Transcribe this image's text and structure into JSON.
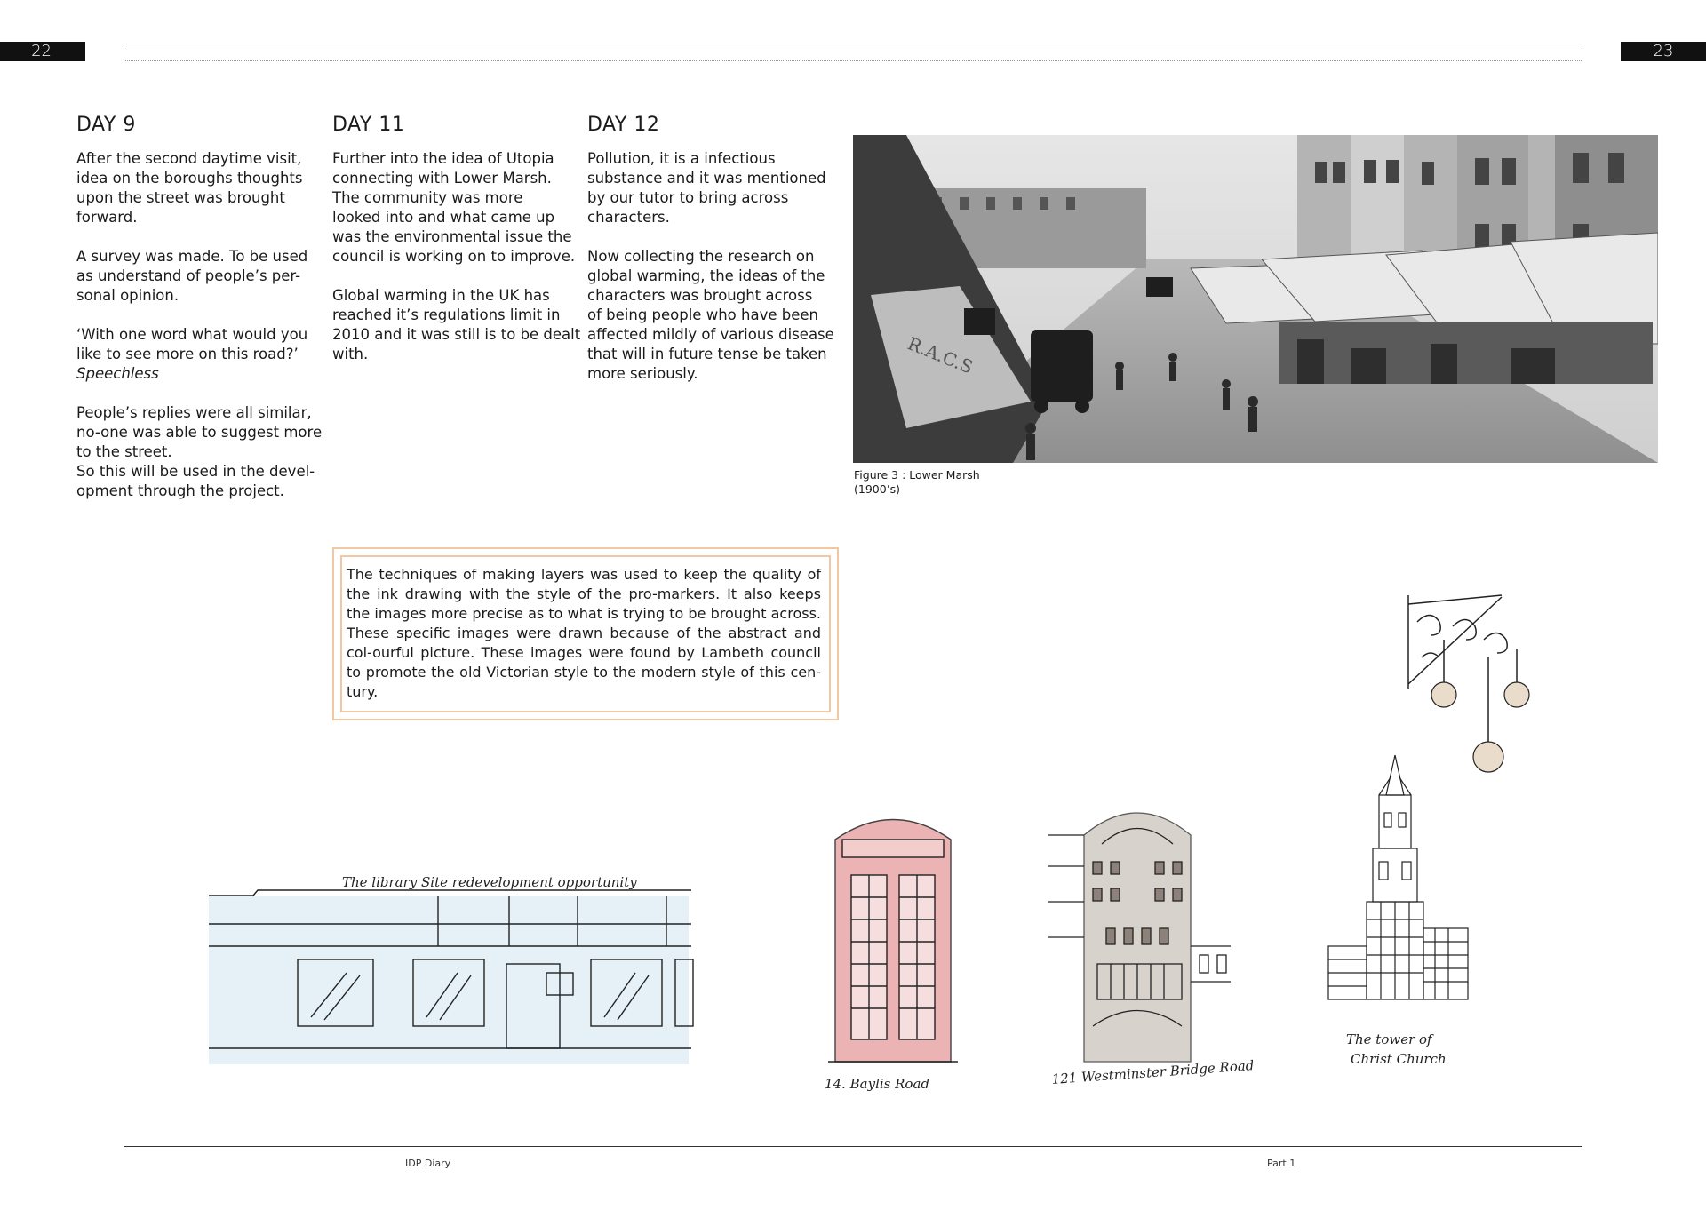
{
  "page_numbers": {
    "left": "22",
    "right": "23"
  },
  "days": [
    {
      "title": "DAY 9",
      "text_parts": [
        "After the second daytime visit,\nidea on the boroughs thoughts\nupon the street was brought\nforward.\n\nA survey was made. To be used\nas understand of people’s per-\nsonal opinion.\n\n‘With one word what would you\nlike to see more on this road?’\n",
        "Speechless",
        "\n\nPeople’s replies were all similar,\nno-one was able to suggest more\nto the street.\nSo this will be used in the devel-\nopment through the project."
      ]
    },
    {
      "title": "DAY 11",
      "text": "Further into the idea of Utopia\nconnecting with Lower Marsh.\nThe community was more\nlooked into and what came up\nwas the environmental issue the\ncouncil is working on to improve.\n\nGlobal warming in the UK has\nreached it’s regulations limit in\n2010 and it was still is to be dealt\nwith."
    },
    {
      "title": "DAY 12",
      "text": "Pollution, it is a infectious\nsubstance and it was mentioned\nby our tutor to bring across\ncharacters.\n\nNow collecting the research on\nglobal warming, the ideas of the\ncharacters was brought across\nof being people who have been\naffected mildly of various disease\nthat will in future tense be taken\nmore seriously."
    }
  ],
  "photo": {
    "caption": "Figure 3 : Lower Marsh\n(1900’s)",
    "sign_text": "R.A.C.S"
  },
  "note_box": {
    "text": "The techniques of making layers was used to keep the quality of the ink drawing with the style of the pro-markers. It also keeps the images more precise as to what is trying to be brought across. These specific images were drawn because of the abstract and col-ourful picture. These images were found by Lambeth council to promote the old Victorian style to the modern style of this cen-tury."
  },
  "sketches": {
    "library": "The library Site redevelopment opportunity",
    "phonebox": "14. Baylis Road",
    "westminster": "121 Westminster Bridge Road",
    "tower_line1": "The tower of",
    "tower_line2": "Christ Church"
  },
  "footer": {
    "left": "IDP Diary",
    "right": "Part 1"
  },
  "colors": {
    "accent_border": "#f2c7a4",
    "phonebox_red": "#e8a6a6",
    "library_blue": "#cfe6ee"
  }
}
